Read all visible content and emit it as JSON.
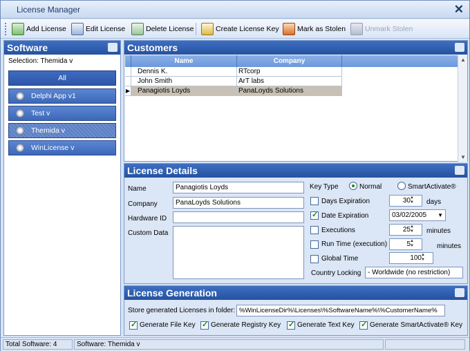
{
  "window": {
    "title": "License Manager"
  },
  "toolbar": {
    "add": "Add License",
    "edit": "Edit License",
    "delete": "Delete License",
    "create": "Create License Key",
    "mark": "Mark as Stolen",
    "unmark": "Unmark Stolen"
  },
  "software": {
    "header": "Software",
    "selection": "Selection: Themida v",
    "all": "All",
    "items": [
      "Delphi App v1",
      "Test v",
      "Themida v",
      "WinLicense v"
    ]
  },
  "customers": {
    "header": "Customers",
    "columns": [
      "Name",
      "Company"
    ],
    "rows": [
      {
        "name": "Dennis K.",
        "company": "RTcorp"
      },
      {
        "name": "John Smith",
        "company": "ArT labs"
      },
      {
        "name": "Panagiotis Loyds",
        "company": "PanaLoyds Solutions"
      }
    ]
  },
  "license": {
    "header": "License Details",
    "name_label": "Name",
    "name": "Panagiotis Loyds",
    "company_label": "Company",
    "company": "PanaLoyds Solutions",
    "hwid_label": "Hardware ID",
    "hwid": "",
    "custom_label": "Custom Data",
    "keytype_label": "Key Type",
    "normal": "Normal",
    "smartactivate": "SmartActivate®",
    "days_exp": "Days Expiration",
    "days_value": "30",
    "days_unit": "days",
    "date_exp": "Date Expiration",
    "date_value": "03/02/2005",
    "executions": "Executions",
    "exec_value": "25",
    "exec_unit": "minutes",
    "runtime": "Run Time (execution)",
    "runtime_value": "5",
    "runtime_unit": "minutes",
    "global": "Global Time",
    "global_value": "100",
    "locking_label": "Country Locking",
    "locking_value": "- Worldwide (no restriction)"
  },
  "generation": {
    "header": "License Generation",
    "folder_label": "Store generated Licenses in folder:",
    "folder_value": "%WinLicenseDir%\\Licenses\\%SoftwareName%\\%CustomerName%",
    "gen_file": "Generate File Key",
    "gen_reg": "Generate Registry Key",
    "gen_text": "Generate Text Key",
    "gen_smart": "Generate SmartActivate® Key"
  },
  "status": {
    "total": "Total Software: 4",
    "software": "Software: Themida v"
  }
}
